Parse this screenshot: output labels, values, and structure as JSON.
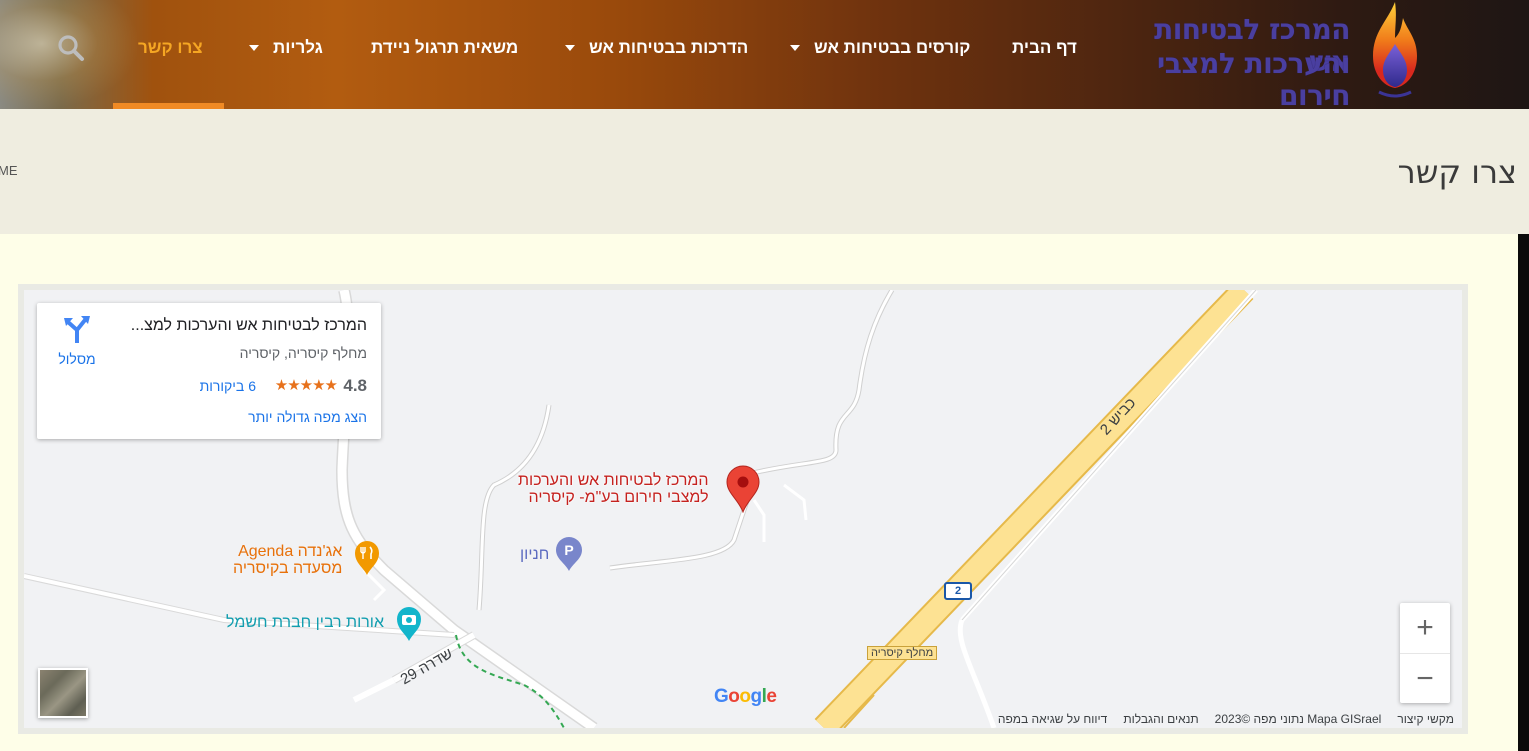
{
  "header": {
    "logo": {
      "line1": "המרכז לבטיחות אש",
      "line2": "והערכות למצבי חירום"
    },
    "nav": [
      {
        "label": "דף הבית",
        "dropdown": false,
        "active": false
      },
      {
        "label": "קורסים בבטיחות אש",
        "dropdown": true,
        "active": false
      },
      {
        "label": "הדרכות בבטיחות אש",
        "dropdown": true,
        "active": false
      },
      {
        "label": "משאית תרגול ניידת",
        "dropdown": false,
        "active": false
      },
      {
        "label": "גלריות",
        "dropdown": true,
        "active": false
      },
      {
        "label": "צרו קשר",
        "dropdown": false,
        "active": true
      }
    ],
    "search_icon": "search-icon",
    "active_color": "#f5a623"
  },
  "page": {
    "title": "צרו קשר",
    "breadcrumb_home": "ME"
  },
  "map": {
    "info_card": {
      "title": "המרכז לבטיחות אש והערכות למצ...",
      "address": "מחלף קיסריה, קיסריה",
      "rating": "4.8",
      "stars": "★★★★★",
      "reviews": "6 ביקורות",
      "bigger_map": "הצג מפה גדולה יותר",
      "directions": "מסלול"
    },
    "labels": {
      "main_line1": "המרכז לבטיחות אש והערכות",
      "main_line2": "למצבי חירום בע\"מ- קיסריה",
      "parking": "חניון",
      "agenda_line1": "אג'נדה Agenda",
      "agenda_line2": "מסעדה בקיסריה",
      "orot": "אורות רבין חברת חשמל",
      "road_2": "כביש 2",
      "road_29": "שדרה 29",
      "exit": "מחלף קיסריה",
      "shield": "2"
    },
    "zoom": {
      "in": "+",
      "out": "−"
    },
    "google": "Google",
    "attribution": {
      "shortcuts": "מקשי קיצור",
      "map_data": "Mapa GISrael נתוני מפה ©2023",
      "terms": "תנאים והגבלות",
      "report": "דיווח על שגיאה במפה"
    },
    "colors": {
      "pin": "#ea4335",
      "highway": "#fde293",
      "highway_edge": "#e6b94a"
    }
  }
}
